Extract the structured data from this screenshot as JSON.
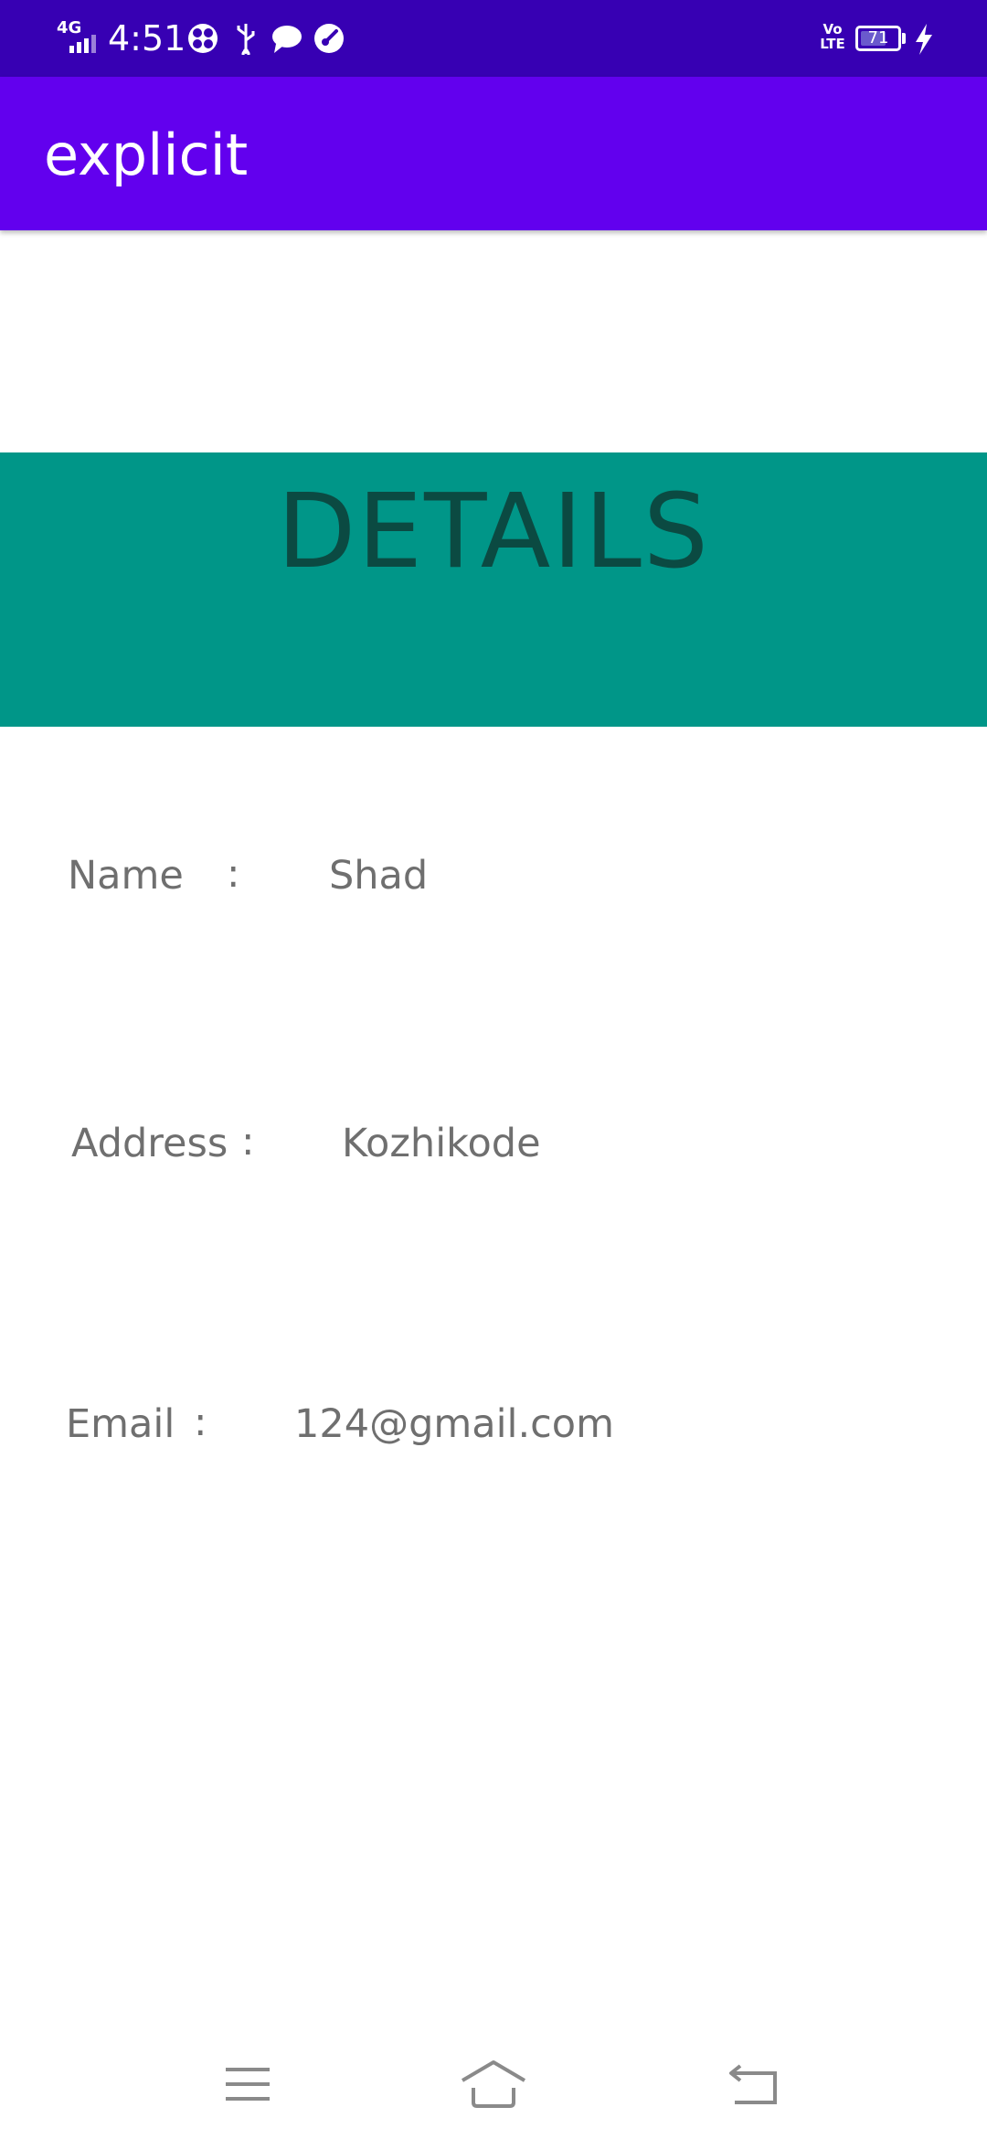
{
  "status_bar": {
    "network": "4G",
    "time": "4:51",
    "volte": "Vo LTE",
    "battery": "71",
    "battery_level": 0.71,
    "icons": [
      "signal-icon",
      "pinwheel-icon",
      "usb-icon",
      "message-icon",
      "speed-icon",
      "battery-icon",
      "charging-icon"
    ]
  },
  "app_bar": {
    "title": "explicit",
    "color": "#6200ee"
  },
  "banner": {
    "heading": "DETAILS",
    "color": "#009688"
  },
  "fields": {
    "name": {
      "label": "Name",
      "separator": ":",
      "value": "Shad"
    },
    "address": {
      "label": "Address",
      "separator": ":",
      "value": "Kozhikode"
    },
    "email": {
      "label": "Email",
      "separator": ":",
      "value": "124@gmail.com"
    }
  },
  "nav_bar": {
    "icons": [
      "menu-icon",
      "home-icon",
      "back-icon"
    ]
  }
}
